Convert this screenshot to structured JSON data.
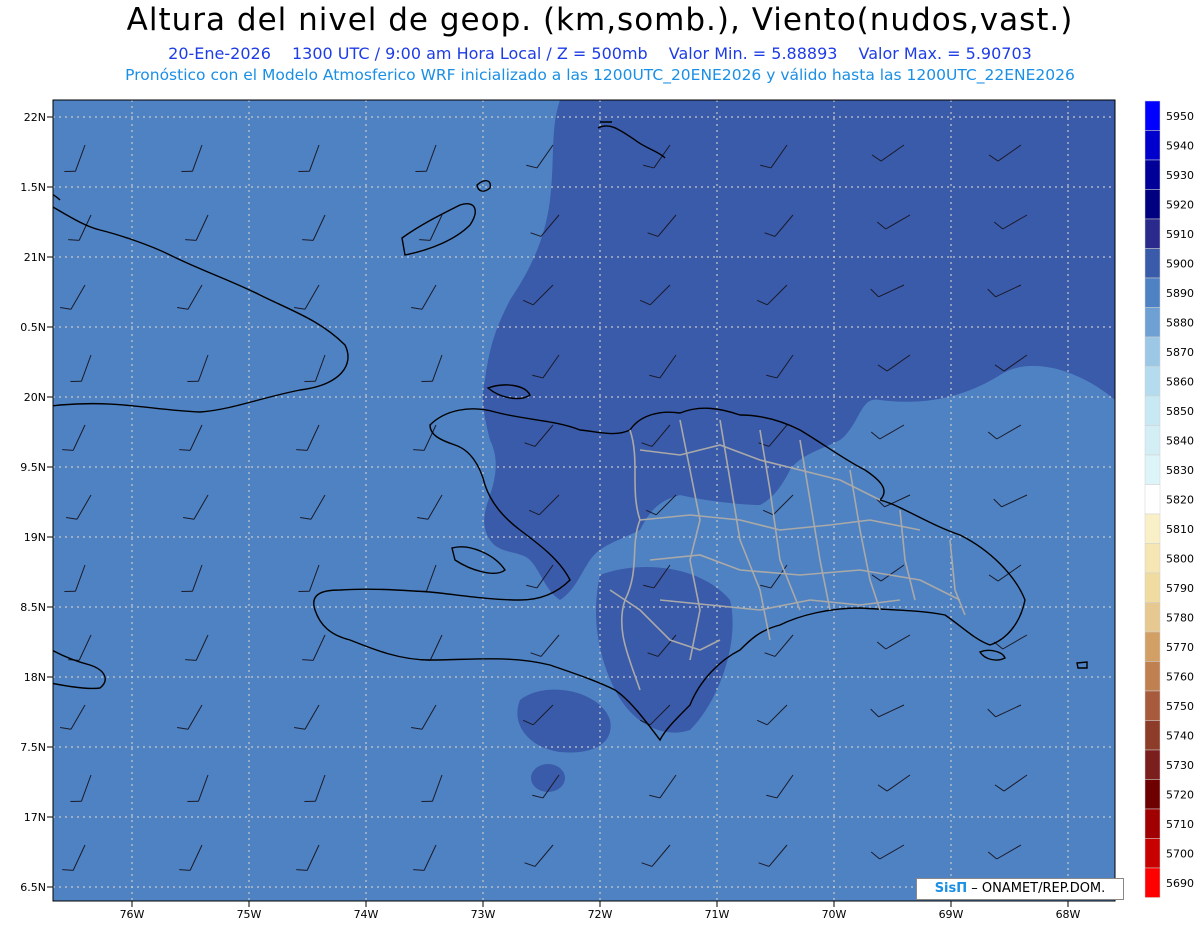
{
  "header": {
    "title": "Altura del nivel de geop. (km,somb.), Viento(nudos,vast.)",
    "date": "20-Ene-2026",
    "time": "1300 UTC / 9:00 am Hora Local / Z = 500mb",
    "min": "Valor Min. = 5.88893",
    "max": "Valor Max. = 5.90703",
    "description": "Pronóstico con el Modelo Atmosferico WRF inicializado a las 1200UTC_20ENE2026 y válido hasta las  1200UTC_22ENE2026"
  },
  "map": {
    "lat_labels": [
      "22N",
      "1.5N",
      "21N",
      "0.5N",
      "20N",
      "9.5N",
      "19N",
      "8.5N",
      "18N",
      "7.5N",
      "17N",
      "6.5N"
    ],
    "lon_labels": [
      "76W",
      "75W",
      "74W",
      "73W",
      "72W",
      "71W",
      "70W",
      "69W",
      "68W"
    ],
    "colors": {
      "background_5890": "#4f82c2",
      "high_5900": "#3a5aaa",
      "coast": "#000000",
      "province_borders": "#a9a9a9",
      "grid": "#c8c8c8"
    }
  },
  "colorbar": {
    "levels": [
      "5950",
      "5940",
      "5930",
      "5920",
      "5910",
      "5900",
      "5890",
      "5880",
      "5870",
      "5860",
      "5850",
      "5840",
      "5830",
      "5820",
      "5810",
      "5800",
      "5790",
      "5780",
      "5770",
      "5760",
      "5750",
      "5740",
      "5730",
      "5720",
      "5710",
      "5700",
      "5690"
    ],
    "colors": [
      "#0000ff",
      "#0000cc",
      "#000099",
      "#000080",
      "#2a2a8c",
      "#3a5aaa",
      "#4f82c2",
      "#6fa0d4",
      "#9cc8e6",
      "#b4dcee",
      "#c8e8f4",
      "#d4eef6",
      "#ddf4f8",
      "#ffffff",
      "#faf0c8",
      "#f5e6b4",
      "#f0dca0",
      "#e6c890",
      "#d2a064",
      "#c08050",
      "#a85a3c",
      "#8c3c28",
      "#7a1e1e",
      "#6e0000",
      "#a00000",
      "#c80000",
      "#ff0000"
    ]
  },
  "credit": {
    "brand": "SisΠ",
    "org": "– ONAMET/REP.DOM."
  }
}
